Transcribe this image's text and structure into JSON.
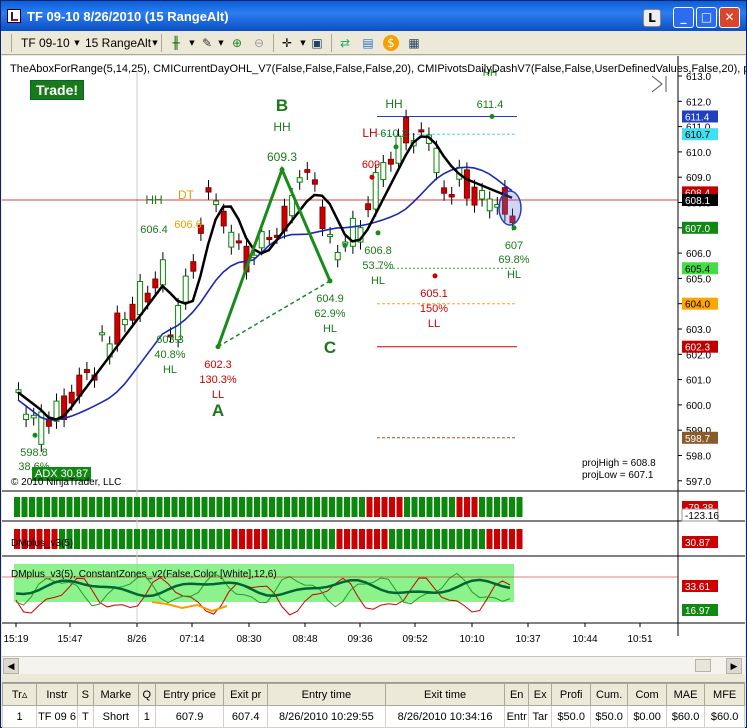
{
  "window": {
    "title": "TF 09-10  8/26/2010 (15 RangeAlt)",
    "buttons": {
      "l": "L",
      "min": "_",
      "max": "□",
      "close": "✕"
    }
  },
  "toolbar": {
    "instrument": "TF 09-10",
    "interval": "15 RangeAlt"
  },
  "chart": {
    "indicator_line": "TheAboxForRange(5,14,25), CMICurrentDayOHL_V7(False,False,False,False,20), CMIPivotsDailyDashV7(False,False,UserDefinedValues,False,20), pro",
    "trade_button": "Trade!",
    "adx_label": "ADX 30.87",
    "copyright": "© 2010 NinjaTrader, LLC",
    "proj_high": "projHigh = 608.8",
    "proj_low": "projLow = 607.1",
    "panel2_label": "DMplus_v3(5)",
    "panel3_label": "DMplus_v3(5), ConstantZones_v2(False,Color [White],12,6)",
    "price_axis": [
      "613.0",
      "612.0",
      "611.0",
      "610.0",
      "609.0",
      "608.0",
      "607.0",
      "606.0",
      "605.0",
      "604.0",
      "603.0",
      "602.0",
      "601.0",
      "600.0",
      "599.0",
      "598.0",
      "597.0"
    ],
    "price_markers": [
      {
        "text": "611.4",
        "bg": "#2040c0"
      },
      {
        "text": "610.7",
        "bg": "#40e0f0"
      },
      {
        "text": "608.4",
        "bg": "#c00000"
      },
      {
        "text": "608.1",
        "bg": "#000000"
      },
      {
        "text": "607.0",
        "bg": "#118811"
      },
      {
        "text": "605.4",
        "bg": "#44dd44"
      },
      {
        "text": "604.0",
        "bg": "#ffa500"
      },
      {
        "text": "602.3",
        "bg": "#c00000"
      },
      {
        "text": "598.7",
        "bg": "#8b5a2b"
      }
    ],
    "panel2_markers": [
      "-79.38",
      "-123.16",
      "30.87"
    ],
    "panel3_markers": [
      "33.61",
      "16.97"
    ],
    "time_axis": [
      "15:19",
      "15:47",
      "8/26",
      "07:14",
      "08:30",
      "08:48",
      "09:36",
      "09:52",
      "10:10",
      "10:37",
      "10:44",
      "10:51"
    ],
    "annotations": {
      "A": "A",
      "B": "B",
      "C": "C",
      "hh_b": "HH",
      "p609_3": "609.3",
      "hh_left": "HH",
      "dt": "DT",
      "p606_4": "606.4",
      "p606_6": "606.6",
      "p603_3": "603.3",
      "pct40_8": "40.8%",
      "hl_1": "HL",
      "p602_3": "602.3",
      "pct130_3": "130.3%",
      "ll_1": "LL",
      "p604_9": "604.9",
      "pct62_9": "62.9%",
      "hl_2": "HL",
      "p606_8": "606.8",
      "pct53_7": "53.7%",
      "hl_3": "HL",
      "hh_mid": "HH",
      "lh": "LH",
      "p610_2": "610.2",
      "p609": "609",
      "p605_1": "605.1",
      "pct150": "150%",
      "ll_2": "LL",
      "hh_top": "HH",
      "p611_4": "611.4",
      "hh_top2": "HH",
      "p607": "607",
      "pct69_8": "69.8%",
      "hl_4": "HL",
      "p598_8": "598.8",
      "pct38": "38.6%"
    }
  },
  "trades": {
    "headers": [
      "Tr▵",
      "Instr",
      "S",
      "Marke",
      "Q",
      "Entry price",
      "Exit pr",
      "Entry time",
      "Exit time",
      "En",
      "Ex",
      "Profi",
      "Cum.",
      "Com",
      "MAE",
      "MFE"
    ],
    "rows": [
      [
        "1",
        "TF 09 6",
        "T",
        "Short",
        "1",
        "607.9",
        "607.4",
        "8/26/2010 10:29:55",
        "8/26/2010 10:34:16",
        "Entr",
        "Tar",
        "$50.0",
        "$50.0",
        "$0.00",
        "$60.0",
        "$60.0"
      ]
    ]
  }
}
